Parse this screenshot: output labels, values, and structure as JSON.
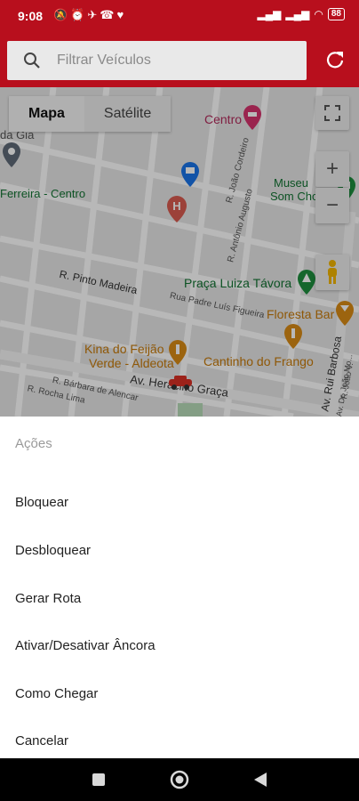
{
  "status_bar": {
    "time": "9:08",
    "left_icons": [
      "mute-icon",
      "alarm-icon",
      "telegram-icon",
      "wifi-call-icon",
      "chat-icon"
    ],
    "battery": "88"
  },
  "search": {
    "placeholder": "Filtrar Veículos"
  },
  "map": {
    "type_buttons": [
      "Mapa",
      "Satélite"
    ],
    "active_type": "Mapa",
    "zoom_in": "+",
    "zoom_out": "−",
    "labels": {
      "ferreira_centro": "Ferreira - Centro",
      "da_gia": "da Gia",
      "centro": "Centro",
      "museu": "Museu",
      "som_cho": "Som Cho",
      "r_pinto_madeira": "R. Pinto Madeira",
      "praca_luiza_tavora": "Praça Luiza Távora",
      "rua_padre_luis_figueira": "Rua Padre Luís Figueira",
      "floresta_bar": "Floresta Bar",
      "kina_do_feijao": "Kina do Feijão",
      "verde_aldeota": "Verde - Aldeota",
      "cantinho_do_frango": "Cantinho do Frango",
      "av_heraclito_graca": "Av. Heráclito Graça",
      "r_barbara_de_alencar": "R. Bárbara de Alencar",
      "r_rocha_lima": "R. Rocha Lima",
      "r_joao_cordeiro": "R. João Cordeiro",
      "r_antonio_augusto": "R. Antônio Augusto",
      "av_rui_barbosa": "Av. Rui Barbosa",
      "r_joao_vicente": "R. João V.",
      "av_dr_joao_moreira": "Av. Dr. João Mo..."
    },
    "colors": {
      "poi_green": "#1e8e3e",
      "poi_orange": "#d98b16",
      "poi_blue": "#1a73e8",
      "poi_pink": "#d6336c",
      "vehicle_red": "#d93025"
    }
  },
  "sheet": {
    "title": "Ações",
    "actions": [
      "Bloquear",
      "Desbloquear",
      "Gerar Rota",
      "Ativar/Desativar Âncora",
      "Como Chegar",
      "Cancelar"
    ]
  },
  "theme": {
    "primary": "#b80f1d"
  }
}
